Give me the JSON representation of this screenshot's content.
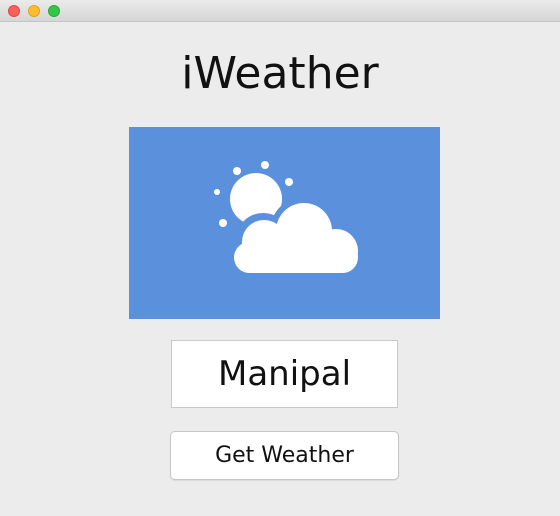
{
  "window": {
    "controls": [
      "close",
      "minimize",
      "zoom"
    ]
  },
  "app": {
    "title": "iWeather"
  },
  "weather_image": {
    "icon": "partly-cloudy-icon",
    "background_color": "#5b90dc"
  },
  "city_input": {
    "value": "Manipal"
  },
  "get_weather_button": {
    "label": "Get Weather"
  }
}
